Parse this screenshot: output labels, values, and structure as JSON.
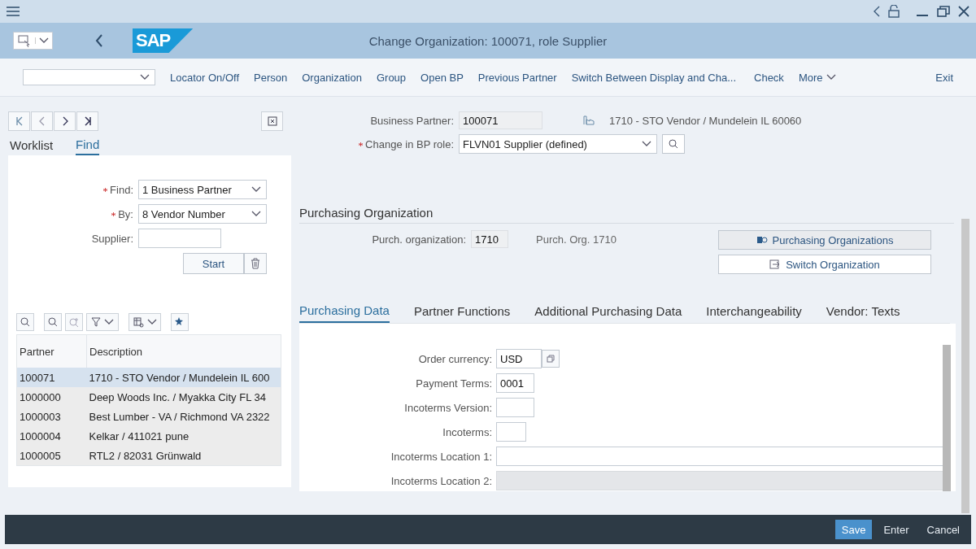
{
  "shell": {
    "logo": "SAP",
    "title": "Change Organization: 100071, role Supplier"
  },
  "toolbar": {
    "items": [
      "Locator On/Off",
      "Person",
      "Organization",
      "Group",
      "Open BP",
      "Previous Partner",
      "Switch Between Display and Cha..."
    ],
    "check": "Check",
    "more": "More",
    "exit": "Exit"
  },
  "locator": {
    "tabs": [
      {
        "label": "Worklist",
        "selected": false
      },
      {
        "label": "Find",
        "selected": true
      }
    ],
    "find": [
      {
        "label": "Find:",
        "required": true,
        "kind": "select",
        "value": "1 Business Partner"
      },
      {
        "label": "By:",
        "required": true,
        "kind": "select",
        "value": "8 Vendor Number"
      },
      {
        "label": "Supplier:",
        "required": false,
        "kind": "input"
      }
    ],
    "start": "Start",
    "table": {
      "columns": [
        "Partner",
        "Description"
      ],
      "rows": [
        {
          "partner": "100071",
          "description": "1710 - STO Vendor / Mundelein IL 600",
          "selected": true
        },
        {
          "partner": "1000000",
          "description": "Deep Woods Inc. / Myakka City FL 34",
          "selected": false
        },
        {
          "partner": "1000003",
          "description": "Best Lumber - VA / Richmond VA 2322",
          "selected": false
        },
        {
          "partner": "1000004",
          "description": "Kelkar / 411021 pune",
          "selected": false
        },
        {
          "partner": "1000005",
          "description": "RTL2 / 82031 Grünwald",
          "selected": false
        }
      ]
    }
  },
  "header": {
    "bp_label": "Business Partner:",
    "bp_value": "100071",
    "bp_description": "1710 - STO Vendor / Mundelein IL 60060",
    "role_label": "Change in BP role:",
    "role_value": "FLVN01 Supplier (defined)"
  },
  "purchasing_org": {
    "title": "Purchasing Organization",
    "label": "Purch. organization:",
    "value": "1710",
    "description": "Purch. Org. 1710",
    "buttons": [
      "Purchasing Organizations",
      "Switch Organization"
    ]
  },
  "tabs": [
    {
      "label": "Purchasing Data",
      "selected": true
    },
    {
      "label": "Partner Functions",
      "selected": false
    },
    {
      "label": "Additional Purchasing Data",
      "selected": false
    },
    {
      "label": "Interchangeability",
      "selected": false
    },
    {
      "label": "Vendor: Texts",
      "selected": false
    }
  ],
  "fields": [
    {
      "label": "Order currency:",
      "value": "USD",
      "kind": "currency",
      "disabled": false
    },
    {
      "label": "Payment Terms:",
      "value": "0001",
      "kind": "short",
      "disabled": false
    },
    {
      "label": "Incoterms Version:",
      "kind": "short",
      "disabled": false
    },
    {
      "label": "Incoterms:",
      "kind": "tiny",
      "disabled": false
    },
    {
      "label": "Incoterms Location 1:",
      "kind": "wide",
      "disabled": false
    },
    {
      "label": "Incoterms Location 2:",
      "kind": "wide",
      "disabled": true
    }
  ],
  "footer": {
    "buttons": [
      {
        "label": "Save",
        "selected": true
      },
      {
        "label": "Enter",
        "selected": false
      },
      {
        "label": "Cancel",
        "selected": false
      }
    ]
  }
}
